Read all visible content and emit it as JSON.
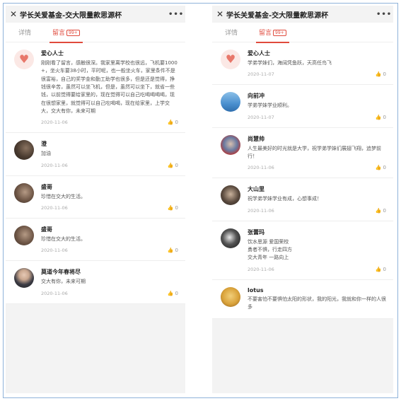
{
  "left": {
    "title": "学长关爱基金-交大限量款思源杯",
    "tabs": [
      {
        "label": "详情"
      },
      {
        "label": "留言",
        "badge": "99+"
      }
    ],
    "comments": [
      {
        "name": "爱心人士",
        "text": "刚刚看了留言，感触很深。我家里离学校也很远，飞机要1000+，坐火车要38小时，平时呢，也一般坐火车，家里条件不是很富裕，自己的奖学金和勤工助学也很多，但是还是觉得，挣钱很辛苦，虽然可以坐飞机，但是，虽然可以坐下，就省一些钱，以前觉得要给家里的，现在觉得可以自己吃喝喝喝喝，现在很想家里，就觉得可以自己吃喝喝，现在给家里，上学交大，交大有你，未来可期",
        "time": "2020-11-06",
        "likes": "0"
      },
      {
        "name": "澄",
        "text": "加油",
        "time": "2020-11-06",
        "likes": "0"
      },
      {
        "name": "盛哥",
        "text": "珍惜在交大的生活。",
        "time": "2020-11-06",
        "likes": "0"
      },
      {
        "name": "盛哥",
        "text": "珍惜在交大的生活。",
        "time": "2020-11-06",
        "likes": "0"
      },
      {
        "name": "莫道今年春将尽",
        "text": "交大有你，未来可期",
        "time": "2020-11-06",
        "likes": "0"
      }
    ]
  },
  "right": {
    "title": "学长关爱基金-交大限量款思源杯",
    "tabs": [
      {
        "label": "详情"
      },
      {
        "label": "留言",
        "badge": "99+"
      }
    ],
    "comments": [
      {
        "name": "爱心人士",
        "text": "学弟学妹们，海阔凭鱼跃，天高任鸟飞",
        "time": "2020-11-07",
        "likes": "0"
      },
      {
        "name": "向前冲",
        "text": "学弟学妹学业顺利。",
        "time": "2020-11-07",
        "likes": "0"
      },
      {
        "name": "尚慧帅",
        "text": "人生最美好的时光就是大学，祝学弟学妹们展翅飞翔，追梦前行！",
        "time": "2020-11-06",
        "likes": "0"
      },
      {
        "name": "大山里",
        "text": "祝学弟学妹学业有成，心想事成！",
        "time": "2020-11-06",
        "likes": "0"
      },
      {
        "name": "张蕾玛",
        "text": "饮水思源 爱国荣校\n勇者不惧，行走四方\n交大青年 一路向上",
        "time": "2020-11-06",
        "likes": "0"
      },
      {
        "name": "lotus",
        "text": "不要害怕不要惧怕太阳的形状，我的阳光，我就和你一样的人很多",
        "time": "",
        "likes": ""
      }
    ]
  },
  "icons": {
    "close": "close-icon",
    "more": "more-icon",
    "heart": "heart-icon",
    "like": "thumbs-up-icon"
  },
  "colors": {
    "accent": "#e04a3c",
    "background": "#f3f3f3"
  }
}
